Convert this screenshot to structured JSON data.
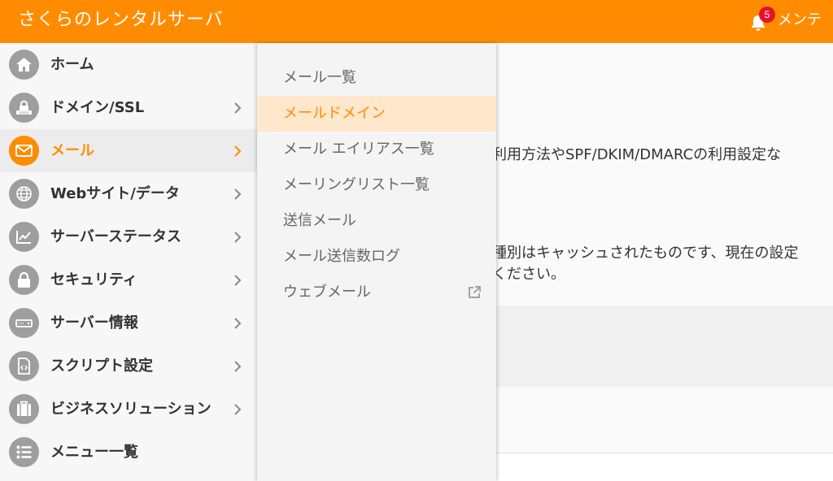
{
  "header": {
    "brand": "さくらのレンタルサーバ",
    "notification_count": "5",
    "maintenance_label": "メンテ"
  },
  "sidebar": {
    "items": [
      {
        "label": "ホーム",
        "icon": "home-icon",
        "chevron": false,
        "active": false
      },
      {
        "label": "ドメイン/SSL",
        "icon": "domain-ssl-icon",
        "chevron": true,
        "active": false
      },
      {
        "label": "メール",
        "icon": "mail-icon",
        "chevron": true,
        "active": true
      },
      {
        "label": "Webサイト/データ",
        "icon": "globe-icon",
        "chevron": true,
        "active": false
      },
      {
        "label": "サーバーステータス",
        "icon": "chart-icon",
        "chevron": true,
        "active": false
      },
      {
        "label": "セキュリティ",
        "icon": "lock-icon",
        "chevron": true,
        "active": false
      },
      {
        "label": "サーバー情報",
        "icon": "server-icon",
        "chevron": true,
        "active": false
      },
      {
        "label": "スクリプト設定",
        "icon": "script-file-icon",
        "chevron": true,
        "active": false
      },
      {
        "label": "ビジネスソリューション",
        "icon": "briefcase-icon",
        "chevron": true,
        "active": false
      },
      {
        "label": "メニュー一覧",
        "icon": "list-icon",
        "chevron": false,
        "active": false
      }
    ]
  },
  "submenu": {
    "items": [
      {
        "label": "メール一覧",
        "active": false
      },
      {
        "label": "メールドメイン",
        "active": true
      },
      {
        "label": "メール エイリアス一覧",
        "active": false
      },
      {
        "label": "メーリングリスト一覧",
        "active": false
      },
      {
        "label": "送信メール",
        "active": false
      },
      {
        "label": "メール送信数ログ",
        "active": false
      },
      {
        "label": "ウェブメール",
        "active": false,
        "external": true
      }
    ]
  },
  "main": {
    "line1": "利用方法やSPF/DKIM/DMARCの利用設定な",
    "line2": "種別はキャッシュされたものです、現在の設定",
    "line3": "ください。"
  },
  "colors": {
    "brand": "#ff8c00",
    "badge": "#e8102a",
    "active_submenu_bg": "#ffe7cc"
  }
}
